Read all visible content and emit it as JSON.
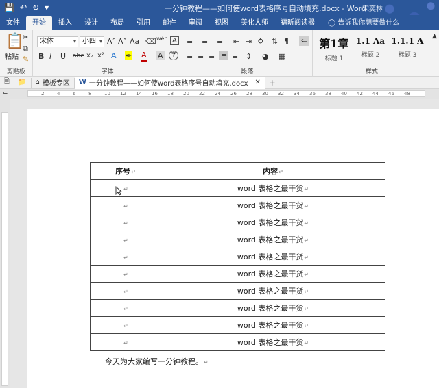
{
  "window": {
    "title": "一分钟教程——如何使word表格序号自动填充.docx - Word",
    "user": "宋奕林"
  },
  "tabs": [
    "文件",
    "开始",
    "插入",
    "设计",
    "布局",
    "引用",
    "邮件",
    "审阅",
    "视图",
    "美化大师",
    "福昕阅读器"
  ],
  "active_tab": "开始",
  "tell_me": "告诉我你想要做什么",
  "ribbon": {
    "clipboard": {
      "paste": "粘贴",
      "label": "剪贴板"
    },
    "font": {
      "name": "宋体",
      "size": "小四",
      "label": "字体"
    },
    "paragraph": {
      "label": "段落"
    },
    "styles": {
      "label": "样式",
      "items": [
        {
          "sample": "第1章",
          "caption": "标题 1"
        },
        {
          "sample": "1.1  Aa",
          "caption": "标题 2"
        },
        {
          "sample": "1.1.1  A",
          "caption": "标题 3"
        }
      ]
    }
  },
  "doc_tabs": {
    "templates": "模板专区",
    "document": "一分钟教程——如何使word表格序号自动填充.docx"
  },
  "table": {
    "headers": [
      "序号",
      "内容"
    ],
    "row_text": "word 表格之最干货",
    "rows": 10
  },
  "caption": "今天为大家编写一分钟教程。",
  "ruler_ticks": [
    "2",
    "4",
    "6",
    "8",
    "10",
    "12",
    "14",
    "16",
    "18",
    "20",
    "22",
    "24",
    "26",
    "28",
    "30",
    "32",
    "34",
    "36",
    "38",
    "40",
    "42",
    "44",
    "46",
    "48"
  ]
}
